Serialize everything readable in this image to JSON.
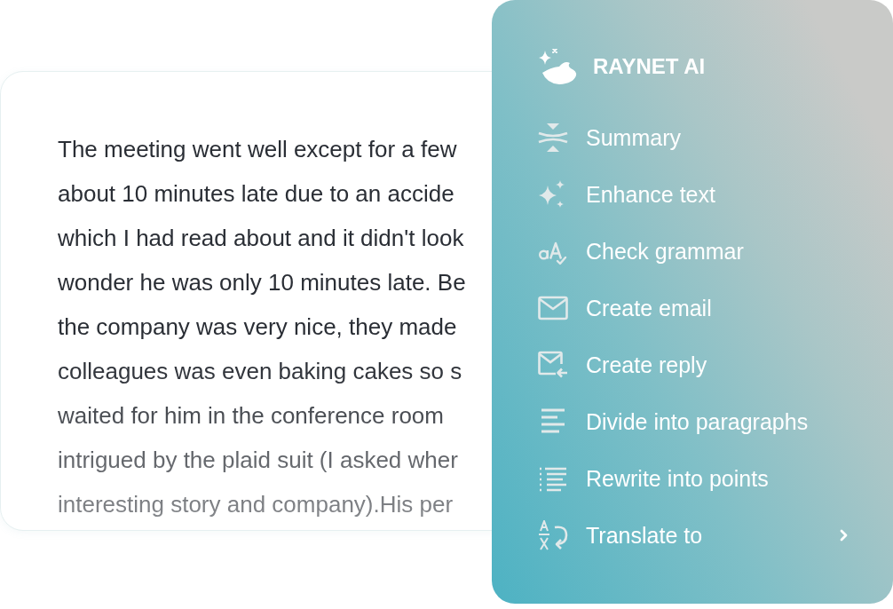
{
  "document": {
    "lines": [
      "The meeting went well except for a few",
      "about 10 minutes late due to an accide",
      "which I had read about and it didn't look",
      "wonder he was only 10 minutes late. Be",
      "the company was very nice, they made",
      "colleagues was even baking cakes so s",
      "waited for him in the conference room",
      "intrigued by the plaid suit (I asked wher",
      "interesting story and company).His per"
    ]
  },
  "ai_menu": {
    "title": "RAYNET AI",
    "items": [
      {
        "label": "Summary",
        "kind": "action"
      },
      {
        "label": "Enhance text",
        "kind": "action"
      },
      {
        "label": "Check grammar",
        "kind": "action"
      },
      {
        "label": "Create email",
        "kind": "action"
      },
      {
        "label": "Create reply",
        "kind": "action"
      },
      {
        "label": "Divide into paragraphs",
        "kind": "action"
      },
      {
        "label": "Rewrite into points",
        "kind": "action"
      },
      {
        "label": "Translate to",
        "kind": "submenu"
      }
    ]
  }
}
